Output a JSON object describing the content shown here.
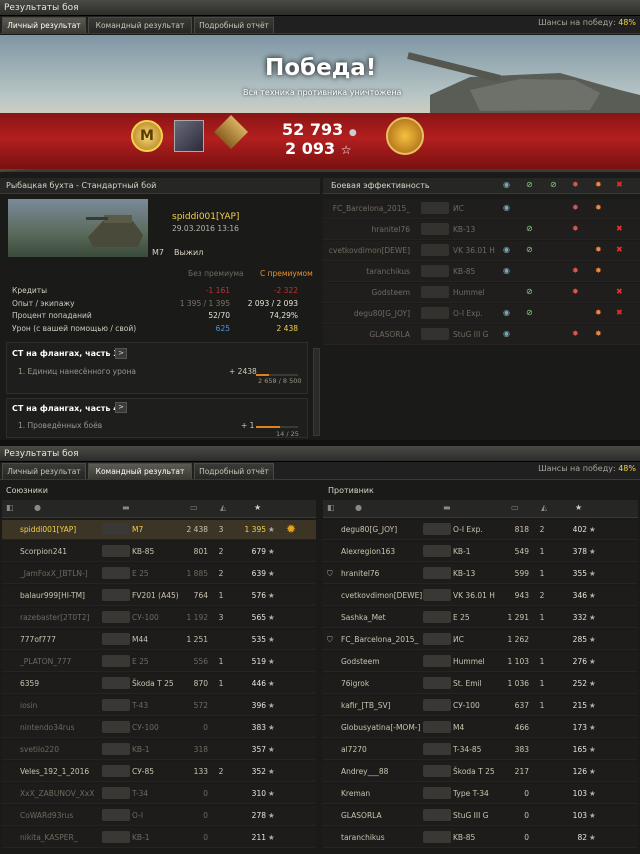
{
  "window1": {
    "title": "Результаты боя",
    "tabs": [
      "Личный результат",
      "Командный результат",
      "Подробный отчёт"
    ],
    "active_tab": 0,
    "chance_label": "Шансы на победу:",
    "chance_value": "48%"
  },
  "banner": {
    "result": "Победа!",
    "subtitle": "Вся техника противника уничтожена",
    "credits": "52 793",
    "xp": "2 093"
  },
  "battle": {
    "map_mode": "Рыбацкая бухта - Стандартный бой",
    "player": "spiddi001[YAP]",
    "datetime": "29.03.2016 13:16",
    "tank": "M7",
    "status": "Выжил",
    "col_no_premium": "Без премиума",
    "col_premium": "С премиумом"
  },
  "stats": [
    {
      "label": "Кредиты",
      "base": "-1 161",
      "prem": "-2 322",
      "base_color": "#c83030",
      "prem_color": "#c83030"
    },
    {
      "label": "Опыт / экипажу",
      "base": "1 395 / 1 395",
      "prem": "2 093 / 2 093",
      "base_color": "#7a766a",
      "prem_color": "#e8e4d8"
    },
    {
      "label": "Процент попаданий",
      "base": "52/70",
      "prem": "74,29%",
      "base_color": "#e8e4d8",
      "prem_color": "#e8e4d8"
    },
    {
      "label": "Урон (с вашей помощью / свой)",
      "base": "625",
      "prem": "2 438",
      "base_color": "#4a9ae0",
      "prem_color": "#f2d24c"
    }
  ],
  "quests": [
    {
      "title": "СТ на флангах, часть 3",
      "btn": ">",
      "desc": "1. Единиц нанесённого урона",
      "value": "+ 2438",
      "progress": "2 658 / 8 500",
      "fraction": 0.31
    },
    {
      "title": "СТ на флангах, часть 4",
      "btn": ">",
      "desc": "1. Проведённых боёв",
      "value": "+ 1",
      "progress": "14 / 25",
      "fraction": 0.56
    }
  ],
  "efficiency": {
    "title": "Боевая эффективность",
    "rows": [
      {
        "name": "FC_Barcelona_2015_",
        "tank": "ИС",
        "dim": true
      },
      {
        "name": "hranitel76",
        "tank": "KB-13",
        "dim": true
      },
      {
        "name": "cvetkovdimon[DEWE]",
        "tank": "VK 36.01 H",
        "dim": true
      },
      {
        "name": "taranchikus",
        "tank": "KB-85",
        "dim": true
      },
      {
        "name": "Godsteem",
        "tank": "Hummel",
        "dim": true
      },
      {
        "name": "degu80[G_JOY]",
        "tank": "O-I Exp.",
        "dim": true
      },
      {
        "name": "GLASORLA",
        "tank": "StuG III G",
        "dim": true
      }
    ]
  },
  "window2": {
    "title": "Результаты боя",
    "tabs": [
      "Личный результат",
      "Командный результат",
      "Подробный отчёт"
    ],
    "active_tab": 1,
    "chance_label": "Шансы на победу:",
    "chance_value": "48%"
  },
  "allies": {
    "title": "Союзники",
    "rows": [
      {
        "name": "spiddi001[YAP]",
        "tank": "M7",
        "dmg": "2 438",
        "kills": "3",
        "xp": "1 395",
        "self": true
      },
      {
        "name": "Scorpion241",
        "tank": "KB-85",
        "dmg": "801",
        "kills": "2",
        "xp": "679"
      },
      {
        "name": "_JamFoxX_[BTLN-]",
        "tank": "E 25",
        "dmg": "1 885",
        "kills": "2",
        "xp": "639",
        "dead": true
      },
      {
        "name": "balaur999[HI-TM]",
        "tank": "FV201 (A45)",
        "dmg": "764",
        "kills": "1",
        "xp": "576"
      },
      {
        "name": "razebaster[2T0T2]",
        "tank": "СУ-100",
        "dmg": "1 192",
        "kills": "3",
        "xp": "565",
        "dead": true
      },
      {
        "name": "777of777",
        "tank": "M44",
        "dmg": "1 251",
        "kills": "",
        "xp": "535"
      },
      {
        "name": "_PLATON_777",
        "tank": "E 25",
        "dmg": "556",
        "kills": "1",
        "xp": "519",
        "dead": true
      },
      {
        "name": "6359",
        "tank": "Škoda T 25",
        "dmg": "870",
        "kills": "1",
        "xp": "446"
      },
      {
        "name": "iosin",
        "tank": "T-43",
        "dmg": "572",
        "kills": "",
        "xp": "396",
        "dead": true
      },
      {
        "name": "nintendo34rus",
        "tank": "СУ-100",
        "dmg": "0",
        "kills": "",
        "xp": "383",
        "dead": true
      },
      {
        "name": "svetilo220",
        "tank": "KB-1",
        "dmg": "318",
        "kills": "",
        "xp": "357",
        "dead": true
      },
      {
        "name": "Veles_192_1_2016",
        "tank": "СУ-85",
        "dmg": "133",
        "kills": "2",
        "xp": "352"
      },
      {
        "name": "XxX_ZABUNOV_XxX",
        "tank": "T-34",
        "dmg": "0",
        "kills": "",
        "xp": "310",
        "dead": true
      },
      {
        "name": "CoWARd93rus",
        "tank": "O-I",
        "dmg": "0",
        "kills": "",
        "xp": "278",
        "dead": true
      },
      {
        "name": "nikita_KASPER_",
        "tank": "KB-1",
        "dmg": "0",
        "kills": "",
        "xp": "211",
        "dead": true
      }
    ]
  },
  "enemies": {
    "title": "Противник",
    "rows": [
      {
        "name": "degu80[G_JOY]",
        "tank": "O-I Exp.",
        "dmg": "818",
        "kills": "2",
        "xp": "402"
      },
      {
        "name": "Alexregion163",
        "tank": "KB-1",
        "dmg": "549",
        "kills": "1",
        "xp": "378"
      },
      {
        "name": "hranitel76",
        "tank": "KB-13",
        "dmg": "599",
        "kills": "1",
        "xp": "355",
        "marker": true
      },
      {
        "name": "cvetkovdimon[DEWE]",
        "tank": "VK 36.01 H",
        "dmg": "943",
        "kills": "2",
        "xp": "346"
      },
      {
        "name": "Sashka_Met",
        "tank": "E 25",
        "dmg": "1 291",
        "kills": "1",
        "xp": "332"
      },
      {
        "name": "FC_Barcelona_2015_",
        "tank": "ИС",
        "dmg": "1 262",
        "kills": "",
        "xp": "285",
        "marker": true
      },
      {
        "name": "Godsteem",
        "tank": "Hummel",
        "dmg": "1 103",
        "kills": "1",
        "xp": "276"
      },
      {
        "name": "76igrok",
        "tank": "St. Emil",
        "dmg": "1 036",
        "kills": "1",
        "xp": "252"
      },
      {
        "name": "kafir_[TB_SV]",
        "tank": "СУ-100",
        "dmg": "637",
        "kills": "1",
        "xp": "215"
      },
      {
        "name": "Globusyatina[-MOM-]",
        "tank": "M4",
        "dmg": "466",
        "kills": "",
        "xp": "173"
      },
      {
        "name": "al7270",
        "tank": "T-34-85",
        "dmg": "383",
        "kills": "",
        "xp": "165"
      },
      {
        "name": "Andrey___88",
        "tank": "Škoda T 25",
        "dmg": "217",
        "kills": "",
        "xp": "126"
      },
      {
        "name": "Kreman",
        "tank": "Type T-34",
        "dmg": "0",
        "kills": "",
        "xp": "103"
      },
      {
        "name": "GLASORLA",
        "tank": "StuG III G",
        "dmg": "0",
        "kills": "",
        "xp": "103"
      },
      {
        "name": "taranchikus",
        "tank": "KB-85",
        "dmg": "0",
        "kills": "",
        "xp": "82"
      }
    ]
  },
  "colors": {
    "gold": "#f2d24c",
    "red": "#b31f1f",
    "ally_text": "#c8c4b0",
    "dead_text": "#6e6a60"
  }
}
